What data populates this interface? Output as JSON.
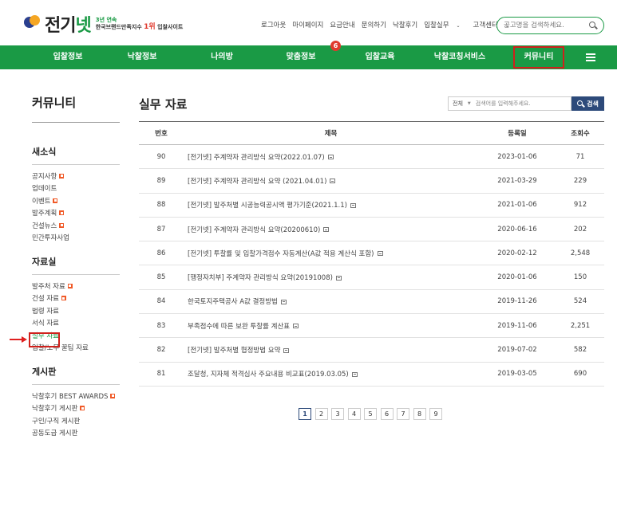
{
  "header": {
    "logo_title": "전기",
    "logo_title_green": "넷",
    "logo_sub_line1": "3년 연속",
    "logo_sub_line2_a": "한국브랜드만족지수 ",
    "logo_sub_line2_red": "1위",
    "logo_sub_line2_b": " 입찰사이트",
    "util_links": [
      "로그아웃",
      "마이페이지",
      "요금안내",
      "문의하기",
      "낙찰후기",
      "입찰실무",
      "고객센터"
    ],
    "search_placeholder": "공고명을 검색하세요."
  },
  "gnb": {
    "items": [
      "입찰정보",
      "낙찰정보",
      "나의방",
      "맞춤정보",
      "입찰교육",
      "낙찰코칭서비스",
      "커뮤니티"
    ],
    "badge": "6",
    "active": "커뮤니티"
  },
  "sidebar": {
    "title": "커뮤니티",
    "groups": [
      {
        "label": "새소식",
        "items": [
          {
            "label": "공지사항",
            "new": true
          },
          {
            "label": "업데이트",
            "new": false
          },
          {
            "label": "이벤트",
            "new": true
          },
          {
            "label": "발주계획",
            "new": true
          },
          {
            "label": "건설뉴스",
            "new": true
          },
          {
            "label": "민간투자사업",
            "new": false
          }
        ]
      },
      {
        "label": "자료실",
        "items": [
          {
            "label": "발주처 자료",
            "new": true
          },
          {
            "label": "건설 자료",
            "new": true
          },
          {
            "label": "법령 자료",
            "new": false
          },
          {
            "label": "서식 자료",
            "new": false
          },
          {
            "label": "실무 자료",
            "new": false,
            "current": true
          },
          {
            "label": "입찰/노무 꿀팁 자료",
            "new": false
          }
        ]
      },
      {
        "label": "게시판",
        "items": [
          {
            "label": "낙찰후기 BEST AWARDS",
            "new": true
          },
          {
            "label": "낙찰후기 게시판",
            "new": true
          },
          {
            "label": "구인/구직 게시판",
            "new": false
          },
          {
            "label": "공동도급 게시판",
            "new": false
          }
        ]
      }
    ]
  },
  "main": {
    "title": "실무 자료",
    "search": {
      "scope": "전체",
      "placeholder": "검색어를 입력해주세요.",
      "button": "검색"
    },
    "columns": {
      "no": "번호",
      "title": "제목",
      "date": "등록일",
      "hits": "조회수"
    },
    "rows": [
      {
        "no": "90",
        "title": "[전기넷] 주계약자 관리방식 요약(2022.01.07)",
        "date": "2023-01-06",
        "hits": "71"
      },
      {
        "no": "89",
        "title": "[전기넷] 주계약자 관리방식 요약 (2021.04.01)",
        "date": "2021-03-29",
        "hits": "229"
      },
      {
        "no": "88",
        "title": "[전기넷] 발주처별 시공능력공시액 평가기준(2021.1.1)",
        "date": "2021-01-06",
        "hits": "912"
      },
      {
        "no": "87",
        "title": "[전기넷] 주계약자 관리방식 요약(20200610)",
        "date": "2020-06-16",
        "hits": "202"
      },
      {
        "no": "86",
        "title": "[전기넷] 투찰률 및 입찰가격점수 자동계산(A값 적용 계산식 포함)",
        "date": "2020-02-12",
        "hits": "2,548"
      },
      {
        "no": "85",
        "title": "[행정자치부] 주계약자 관리방식 요약(20191008)",
        "date": "2020-01-06",
        "hits": "150"
      },
      {
        "no": "84",
        "title": "한국토지주택공사 A값 결정방법",
        "date": "2019-11-26",
        "hits": "524"
      },
      {
        "no": "83",
        "title": "부족점수에 따른 보완 투찰률 계산표",
        "date": "2019-11-06",
        "hits": "2,251"
      },
      {
        "no": "82",
        "title": "[전기넷] 발주처별 협정방법 요약",
        "date": "2019-07-02",
        "hits": "582"
      },
      {
        "no": "81",
        "title": "조달청, 지자체 적격심사 주요내용 비교표(2019.03.05)",
        "date": "2019-03-05",
        "hits": "690"
      }
    ],
    "pages": [
      "1",
      "2",
      "3",
      "4",
      "5",
      "6",
      "7",
      "8",
      "9"
    ],
    "current_page": "1"
  },
  "colors": {
    "brand_green": "#1a9a45",
    "accent_red": "#d0211c",
    "navy": "#2d4a7a",
    "new_badge": "#f05a28"
  }
}
